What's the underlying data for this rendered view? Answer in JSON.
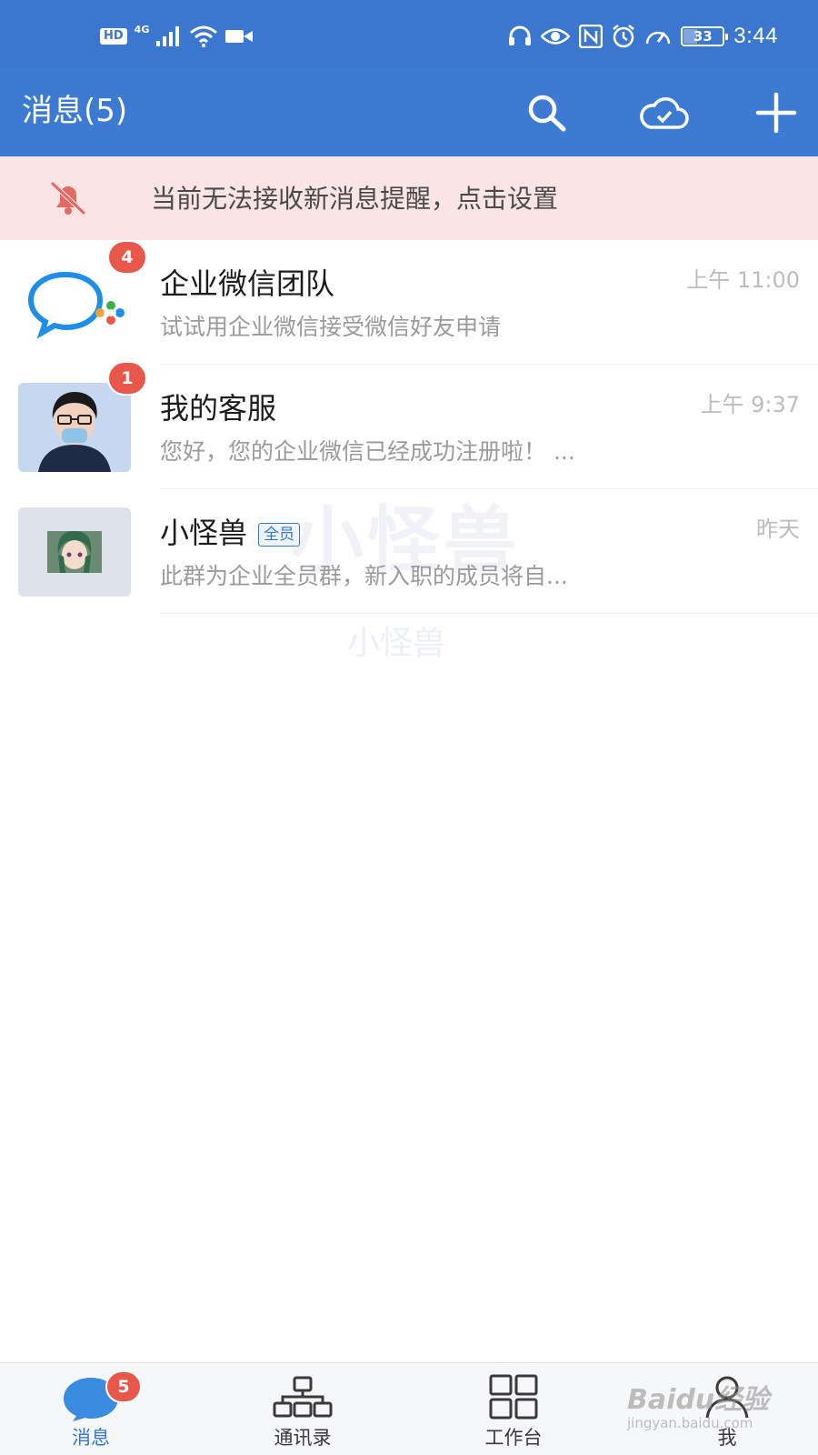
{
  "status_bar": {
    "hd": "HD",
    "signal_label": "4G",
    "battery": "33",
    "time": "3:44",
    "icons": [
      "headset-icon",
      "eye-icon",
      "nfc-icon",
      "alarm-icon",
      "speed-icon"
    ]
  },
  "header": {
    "title": "消息(5)",
    "icons": [
      "search-icon",
      "cloud-icon",
      "add-icon"
    ]
  },
  "notice": {
    "text": "当前无法接收新消息提醒，点击设置",
    "icon": "bell-off-icon",
    "color": "#fbe4e6"
  },
  "conversations": [
    {
      "name": "企业微信团队",
      "preview": "试试用企业微信接受微信好友申请",
      "time": "上午 11:00",
      "badge": "4",
      "avatar": "wecom-logo-icon"
    },
    {
      "name": "我的客服",
      "preview": "您好，您的企业微信已经成功注册啦！ ...",
      "time": "上午 9:37",
      "badge": "1",
      "avatar": "service-agent-photo"
    },
    {
      "name": "小怪兽",
      "tag": "全员",
      "preview": "此群为企业全员群，新入职的成员将自...",
      "time": "昨天",
      "avatar": "group-anime-photo"
    }
  ],
  "watermark": {
    "big": "小怪兽",
    "small": "小怪兽"
  },
  "bottom_nav": [
    {
      "label": "消息",
      "icon": "chat-bubble-icon",
      "badge": "5",
      "active": true
    },
    {
      "label": "通讯录",
      "icon": "org-chart-icon",
      "active": false
    },
    {
      "label": "工作台",
      "icon": "grid-icon",
      "active": false
    },
    {
      "label": "我",
      "icon": "person-icon",
      "active": false
    }
  ],
  "overlay_watermark": {
    "brand": "Baidu经验",
    "url": "jingyan.baidu.com"
  },
  "colors": {
    "primary": "#3d7bd2",
    "badge": "#e8584a"
  }
}
